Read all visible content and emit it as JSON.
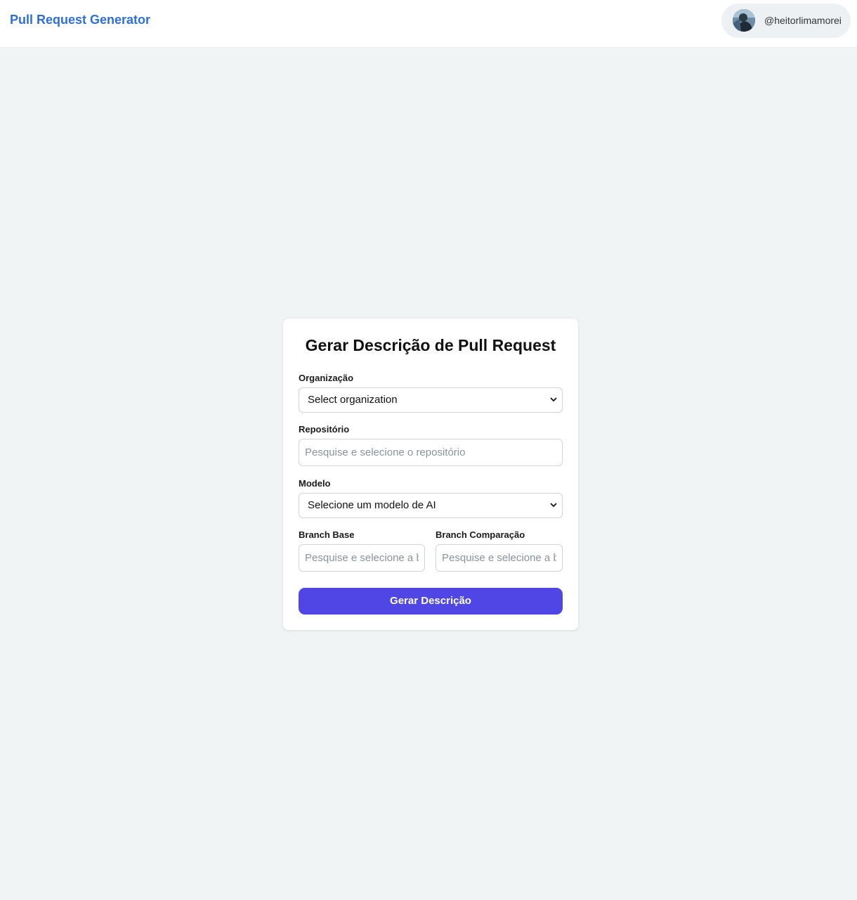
{
  "header": {
    "brand": "Pull Request Generator",
    "username": "@heitorlimamorei"
  },
  "form": {
    "title": "Gerar Descrição de Pull Request",
    "organization": {
      "label": "Organização",
      "selected": "Select organization"
    },
    "repository": {
      "label": "Repositório",
      "placeholder": "Pesquise e selecione o repositório"
    },
    "model": {
      "label": "Modelo",
      "selected": "Selecione um modelo de AI"
    },
    "branch_base": {
      "label": "Branch Base",
      "placeholder": "Pesquise e selecione a branch base"
    },
    "branch_compare": {
      "label": "Branch Comparação",
      "placeholder": "Pesquise e selecione a branch de comparação"
    },
    "submit_label": "Gerar Descrição"
  },
  "colors": {
    "brand": "#2e6fdc",
    "button": "#4f46e5",
    "background": "#f0f4f5"
  }
}
